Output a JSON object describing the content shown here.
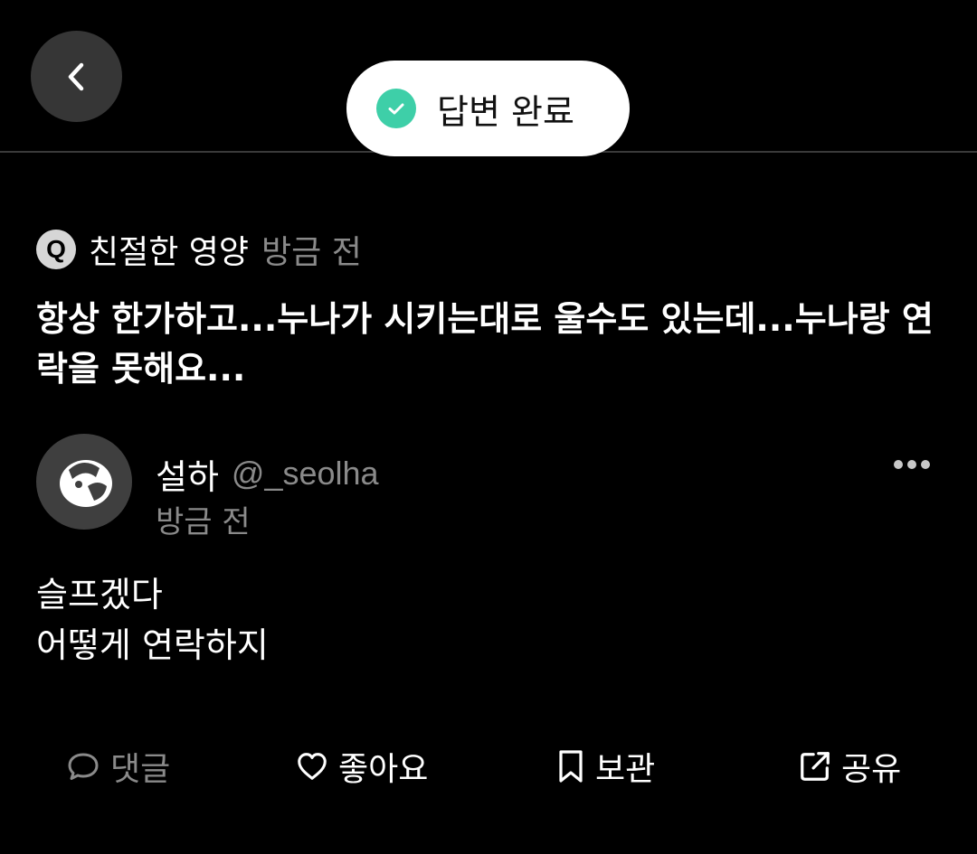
{
  "header": {
    "back_label": "back",
    "toast": {
      "text": "답변 완료",
      "check_color": "#3ecfa8"
    }
  },
  "question": {
    "badge": "Q",
    "author": "친절한 영양",
    "time": "방금 전",
    "text": "항상 한가하고...누나가 시키는대로 울수도 있는데...누나랑 연락을 못해요..."
  },
  "reply": {
    "name": "설하",
    "handle": "@_seolha",
    "time": "방금 전",
    "lines": [
      "슬프겠다",
      "어떻게 연락하지"
    ],
    "more_icon": "ellipsis-icon"
  },
  "actions": [
    {
      "icon": "comment-icon",
      "label": "댓글",
      "enabled": false
    },
    {
      "icon": "heart-icon",
      "label": "좋아요",
      "enabled": true
    },
    {
      "icon": "bookmark-icon",
      "label": "보관",
      "enabled": true
    },
    {
      "icon": "share-icon",
      "label": "공유",
      "enabled": true
    }
  ],
  "colors": {
    "background": "#000000",
    "muted_text": "#8a8a8a",
    "divider": "#3a3a3a",
    "accent_check": "#3ecfa8"
  }
}
